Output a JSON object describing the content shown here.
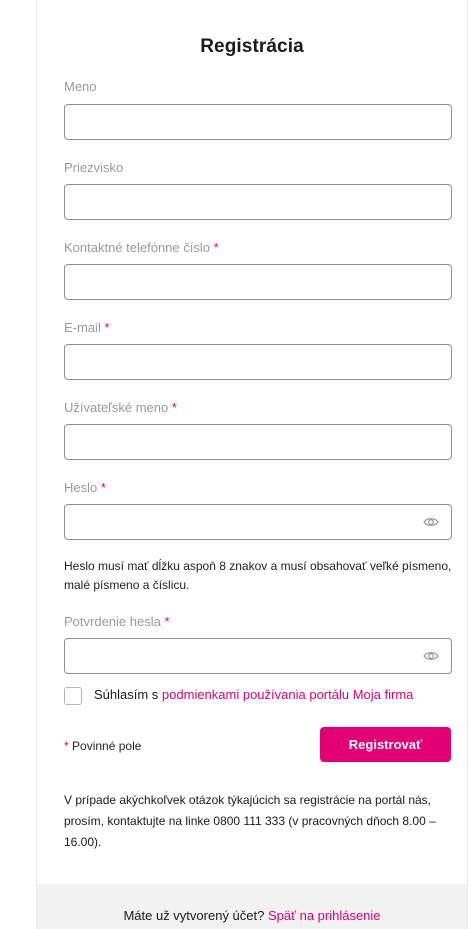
{
  "form": {
    "title": "Registrácia",
    "required_marker": "*",
    "fields": {
      "first_name": {
        "label": "Meno",
        "value": ""
      },
      "last_name": {
        "label": "Priezvisko",
        "value": ""
      },
      "phone": {
        "label": "Kontaktné telefónne číslo",
        "value": ""
      },
      "email": {
        "label": "E-mail",
        "value": ""
      },
      "username": {
        "label": "Užívateľské meno",
        "value": ""
      },
      "password": {
        "label": "Heslo",
        "value": ""
      },
      "password_confirm": {
        "label": "Potvrdenie hesla",
        "value": ""
      }
    },
    "password_hint": "Heslo musí mať dĺžku aspoň 8 znakov a musí obsahovať veľké písmeno, malé písmeno a číslicu.",
    "terms": {
      "prefix": "Súhlasím s ",
      "link_text": "podmienkami používania portálu Moja firma",
      "checked": false
    },
    "required_note": "Povinné pole",
    "submit_label": "Registrovať",
    "info_text": "V prípade akýchkoľvek otázok týkajúcich sa registrácie na portál nás, prosím, kontaktujte na linke 0800 111 333 (v pracovných dňoch 8.00 – 16.00)."
  },
  "footer": {
    "prefix": "Máte už vytvorený účet? ",
    "link_text": "Späť na prihlásenie"
  },
  "icons": {
    "show_password": "eye-icon"
  },
  "colors": {
    "accent": "#e20074",
    "label": "#9a9a9a",
    "input_border": "#8f8f8f",
    "footer_bg": "#f2f2f2"
  }
}
